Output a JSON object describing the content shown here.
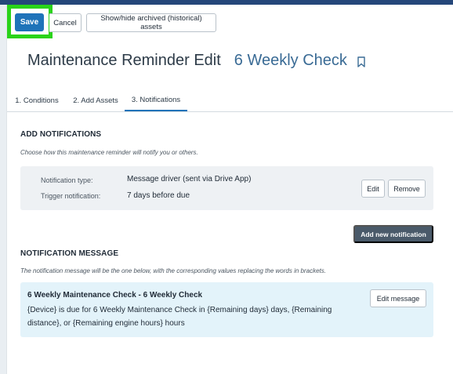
{
  "toolbar": {
    "save_label": "Save",
    "cancel_label": "Cancel",
    "archived_label": "Show/hide archived (historical) assets"
  },
  "header": {
    "title": "Maintenance Reminder Edit",
    "subtitle": "6 Weekly Check",
    "bookmark_icon": "bookmark-icon"
  },
  "tabs": [
    {
      "label": "1. Conditions"
    },
    {
      "label": "2. Add Assets"
    },
    {
      "label": "3. Notifications",
      "active": true
    }
  ],
  "add_notifications": {
    "heading": "ADD NOTIFICATIONS",
    "hint": "Choose how this maintenance reminder will notify you or others.",
    "type_label": "Notification type:",
    "type_value": "Message driver (sent via Drive App)",
    "trigger_label": "Trigger notification:",
    "trigger_value": "7 days before due",
    "edit_label": "Edit",
    "remove_label": "Remove",
    "add_button_label": "Add new notification"
  },
  "notification_message": {
    "heading": "NOTIFICATION MESSAGE",
    "hint": "The notification message will be the one below, with the corresponding values replacing the words in brackets.",
    "title": "6 Weekly Maintenance Check - 6 Weekly Check",
    "body": "{Device} is due for 6 Weekly Maintenance Check in {Remaining days} days, {Remaining distance}, or {Remaining engine hours} hours",
    "edit_message_label": "Edit message"
  },
  "colors": {
    "primary": "#1e73b9",
    "highlight": "#2ad31a",
    "title_accent": "#3a6b95",
    "message_bg": "#e3f3fa",
    "add_button_bg": "#4a5a6a"
  }
}
